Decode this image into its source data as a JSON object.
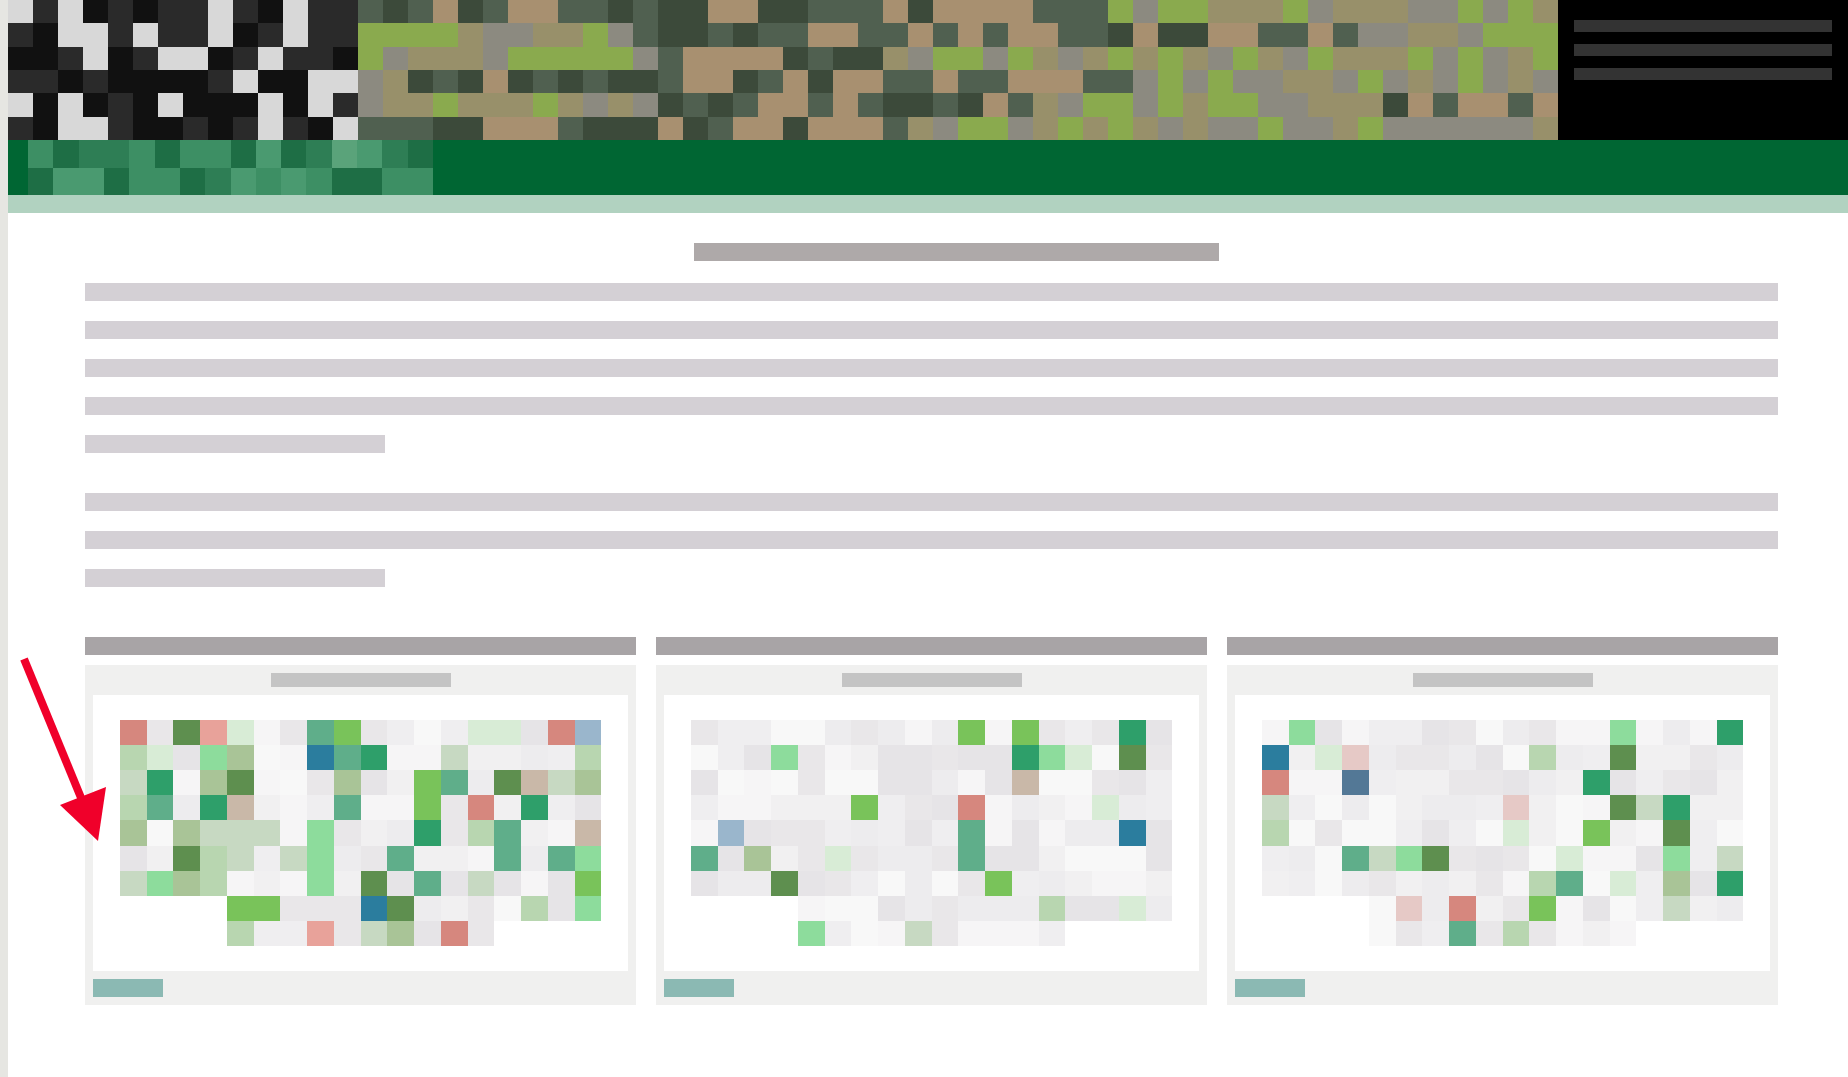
{
  "header": {
    "kind": "pixelated-banner"
  },
  "nav": {
    "kind": "pixelated-menu"
  },
  "heading": {
    "kind": "pixelated"
  },
  "paragraphs": [
    {
      "lines": [
        {
          "kind": "full"
        },
        {
          "kind": "full"
        },
        {
          "kind": "full"
        },
        {
          "kind": "full"
        },
        {
          "kind": "short"
        }
      ]
    },
    {
      "lines": [
        {
          "kind": "full"
        },
        {
          "kind": "full"
        },
        {
          "kind": "short"
        }
      ]
    }
  ],
  "panels": [
    {
      "kind": "dense-map"
    },
    {
      "kind": "sparse-map"
    },
    {
      "kind": "medium-map"
    }
  ],
  "annotation": {
    "kind": "arrow",
    "color": "#f0002a"
  }
}
